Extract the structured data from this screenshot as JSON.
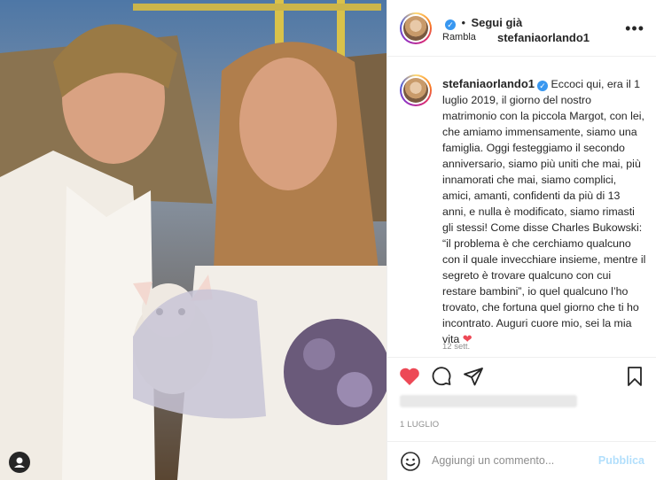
{
  "post": {
    "username": "stefaniaorlando1",
    "verified_icon": "✓",
    "separator": "•",
    "follow_label": "Segui già",
    "location": "Rambla",
    "more_icon": "•••"
  },
  "caption": {
    "username": "stefaniaorlando1",
    "text": "Eccoci qui, era il 1 luglio 2019, il giorno del nostro matrimonio con la piccola Margot, con lei, che amiamo immensamente, siamo una famiglia. Oggi festeggiamo il secondo anniversario, siamo più uniti che mai, più innamorati che mai, siamo complici, amici, amanti, confidenti da più di 13 anni, e nulla è modificato, siamo rimasti gli stessi! Come disse Charles Bukowski: “il problema è che cerchiamo qualcuno con il quale invecchiare insieme, mentre il segreto è trovare qualcuno con cui restare bambini”, io quel qualcuno l’ho trovato, che fortuna quel giorno che ti ho incontrato. Auguri cuore mio, sei la mia vita",
    "heart": "❤",
    "time": "12 sett."
  },
  "footer": {
    "date": "1 LUGLIO",
    "comment_placeholder": "Aggiungi un commento...",
    "publish_label": "Pubblica"
  },
  "colors": {
    "like_red": "#ed4956",
    "publish_blue_disabled": "#b2dffc",
    "verified_blue": "#3897f0"
  }
}
